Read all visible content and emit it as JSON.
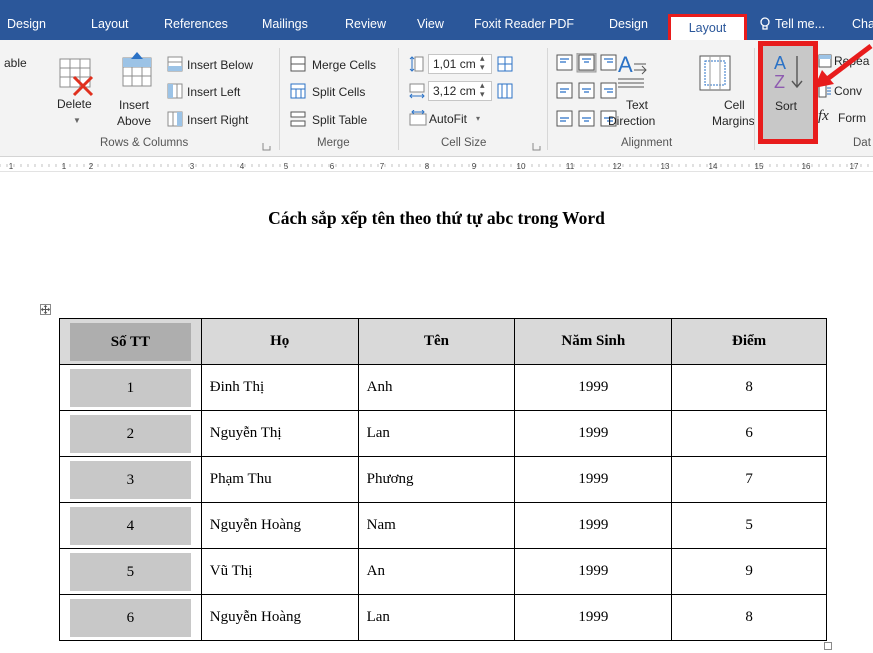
{
  "tabs": {
    "design1": "Design",
    "layout1": "Layout",
    "references": "References",
    "mailings": "Mailings",
    "review": "Review",
    "view": "View",
    "foxit": "Foxit Reader PDF",
    "design2": "Design",
    "layout2": "Layout",
    "tell_me": "Tell me...",
    "cha": "Cha"
  },
  "ribbon": {
    "table_partial": "able",
    "delete": "Delete",
    "insert_above_1": "Insert",
    "insert_above_2": "Above",
    "insert_below": "Insert Below",
    "insert_left": "Insert Left",
    "insert_right": "Insert Right",
    "rows_columns": "Rows & Columns",
    "merge_cells": "Merge Cells",
    "split_cells": "Split Cells",
    "split_table": "Split Table",
    "merge": "Merge",
    "height_value": "1,01 cm",
    "width_value": "3,12 cm",
    "autofit": "AutoFit",
    "cell_size": "Cell Size",
    "text_direction_1": "Text",
    "text_direction_2": "Direction",
    "cell_margins_1": "Cell",
    "cell_margins_2": "Margins",
    "alignment": "Alignment",
    "sort": "Sort",
    "sort_icon_a": "A",
    "sort_icon_z": "Z",
    "repeat": "Repea",
    "convert": "Conv",
    "formula": "Form",
    "data": "Dat"
  },
  "ruler": {
    "numbers": [
      "1",
      "1",
      "2",
      "3",
      "4",
      "5",
      "6",
      "7",
      "8",
      "9",
      "10",
      "11",
      "12",
      "13",
      "14",
      "15",
      "16",
      "17"
    ]
  },
  "document": {
    "title": "Cách sắp xếp tên theo thứ tự abc trong Word",
    "headers": [
      "Số TT",
      "Họ",
      "Tên",
      "Năm Sinh",
      "Điểm"
    ],
    "rows": [
      [
        "1",
        "Đinh Thị",
        "Anh",
        "1999",
        "8"
      ],
      [
        "2",
        "Nguyễn Thị",
        "Lan",
        "1999",
        "6"
      ],
      [
        "3",
        "Phạm Thu",
        "Phương",
        "1999",
        "7"
      ],
      [
        "4",
        "Nguyễn Hoàng",
        "Nam",
        "1999",
        "5"
      ],
      [
        "5",
        "Vũ Thị",
        "An",
        "1999",
        "9"
      ],
      [
        "6",
        "Nguyễn Hoàng",
        "Lan",
        "1999",
        "8"
      ]
    ]
  },
  "colors": {
    "tab_bar": "#2b579a",
    "highlight": "#e81c1c",
    "sort_active": "#c8c8c8",
    "header_fill": "#d9d9d9"
  }
}
